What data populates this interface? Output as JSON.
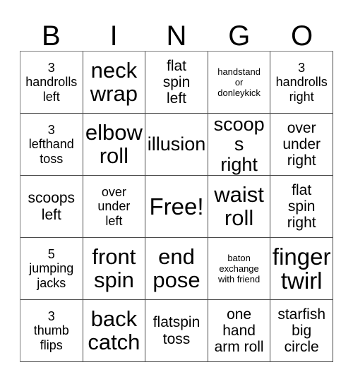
{
  "card": {
    "title_letters": [
      "B",
      "I",
      "N",
      "G",
      "O"
    ],
    "columns": 5,
    "rows": 5,
    "free_space_label": "Free!",
    "free_space_position": {
      "row": 3,
      "col": 3
    },
    "colors": {
      "background": "#ffffff",
      "text": "#000000",
      "grid_line": "#4a4a4a"
    },
    "cells": [
      {
        "text": "3\nhandrolls\nleft",
        "size": "sm"
      },
      {
        "text": "neck\nwrap",
        "size": "xl"
      },
      {
        "text": "flat\nspin\nleft",
        "size": "md"
      },
      {
        "text": "handstand\nor\ndonleykick",
        "size": "xs"
      },
      {
        "text": "3\nhandrolls\nright",
        "size": "sm"
      },
      {
        "text": "3\nlefthand\ntoss",
        "size": "sm"
      },
      {
        "text": "elbow\nroll",
        "size": "xl"
      },
      {
        "text": "illusion",
        "size": "lg"
      },
      {
        "text": "scoops\nright",
        "size": "lg"
      },
      {
        "text": "over\nunder\nright",
        "size": "md"
      },
      {
        "text": "scoops\nleft",
        "size": "md"
      },
      {
        "text": "over\nunder\nleft",
        "size": "sm"
      },
      {
        "text": "Free!",
        "size": "xxl"
      },
      {
        "text": "waist\nroll",
        "size": "xl"
      },
      {
        "text": "flat\nspin\nright",
        "size": "md"
      },
      {
        "text": "5\njumping\njacks",
        "size": "sm"
      },
      {
        "text": "front\nspin",
        "size": "xl"
      },
      {
        "text": "end\npose",
        "size": "xl"
      },
      {
        "text": "baton\nexchange\nwith friend",
        "size": "xs"
      },
      {
        "text": "finger\ntwirl",
        "size": "xxl"
      },
      {
        "text": "3\nthumb\nflips",
        "size": "sm"
      },
      {
        "text": "back\ncatch",
        "size": "xl"
      },
      {
        "text": "flatspin\ntoss",
        "size": "md"
      },
      {
        "text": "one\nhand\narm roll",
        "size": "md"
      },
      {
        "text": "starfish\nbig\ncircle",
        "size": "md"
      }
    ]
  }
}
